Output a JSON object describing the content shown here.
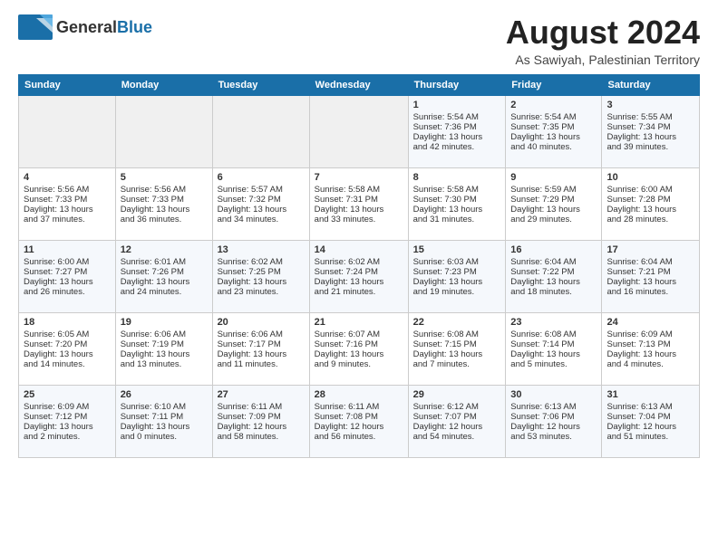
{
  "header": {
    "logo_general": "General",
    "logo_blue": "Blue",
    "month_title": "August 2024",
    "location": "As Sawiyah, Palestinian Territory"
  },
  "days_of_week": [
    "Sunday",
    "Monday",
    "Tuesday",
    "Wednesday",
    "Thursday",
    "Friday",
    "Saturday"
  ],
  "weeks": [
    [
      {
        "day": "",
        "info": ""
      },
      {
        "day": "",
        "info": ""
      },
      {
        "day": "",
        "info": ""
      },
      {
        "day": "",
        "info": ""
      },
      {
        "day": "1",
        "info": "Sunrise: 5:54 AM\nSunset: 7:36 PM\nDaylight: 13 hours\nand 42 minutes."
      },
      {
        "day": "2",
        "info": "Sunrise: 5:54 AM\nSunset: 7:35 PM\nDaylight: 13 hours\nand 40 minutes."
      },
      {
        "day": "3",
        "info": "Sunrise: 5:55 AM\nSunset: 7:34 PM\nDaylight: 13 hours\nand 39 minutes."
      }
    ],
    [
      {
        "day": "4",
        "info": "Sunrise: 5:56 AM\nSunset: 7:33 PM\nDaylight: 13 hours\nand 37 minutes."
      },
      {
        "day": "5",
        "info": "Sunrise: 5:56 AM\nSunset: 7:33 PM\nDaylight: 13 hours\nand 36 minutes."
      },
      {
        "day": "6",
        "info": "Sunrise: 5:57 AM\nSunset: 7:32 PM\nDaylight: 13 hours\nand 34 minutes."
      },
      {
        "day": "7",
        "info": "Sunrise: 5:58 AM\nSunset: 7:31 PM\nDaylight: 13 hours\nand 33 minutes."
      },
      {
        "day": "8",
        "info": "Sunrise: 5:58 AM\nSunset: 7:30 PM\nDaylight: 13 hours\nand 31 minutes."
      },
      {
        "day": "9",
        "info": "Sunrise: 5:59 AM\nSunset: 7:29 PM\nDaylight: 13 hours\nand 29 minutes."
      },
      {
        "day": "10",
        "info": "Sunrise: 6:00 AM\nSunset: 7:28 PM\nDaylight: 13 hours\nand 28 minutes."
      }
    ],
    [
      {
        "day": "11",
        "info": "Sunrise: 6:00 AM\nSunset: 7:27 PM\nDaylight: 13 hours\nand 26 minutes."
      },
      {
        "day": "12",
        "info": "Sunrise: 6:01 AM\nSunset: 7:26 PM\nDaylight: 13 hours\nand 24 minutes."
      },
      {
        "day": "13",
        "info": "Sunrise: 6:02 AM\nSunset: 7:25 PM\nDaylight: 13 hours\nand 23 minutes."
      },
      {
        "day": "14",
        "info": "Sunrise: 6:02 AM\nSunset: 7:24 PM\nDaylight: 13 hours\nand 21 minutes."
      },
      {
        "day": "15",
        "info": "Sunrise: 6:03 AM\nSunset: 7:23 PM\nDaylight: 13 hours\nand 19 minutes."
      },
      {
        "day": "16",
        "info": "Sunrise: 6:04 AM\nSunset: 7:22 PM\nDaylight: 13 hours\nand 18 minutes."
      },
      {
        "day": "17",
        "info": "Sunrise: 6:04 AM\nSunset: 7:21 PM\nDaylight: 13 hours\nand 16 minutes."
      }
    ],
    [
      {
        "day": "18",
        "info": "Sunrise: 6:05 AM\nSunset: 7:20 PM\nDaylight: 13 hours\nand 14 minutes."
      },
      {
        "day": "19",
        "info": "Sunrise: 6:06 AM\nSunset: 7:19 PM\nDaylight: 13 hours\nand 13 minutes."
      },
      {
        "day": "20",
        "info": "Sunrise: 6:06 AM\nSunset: 7:17 PM\nDaylight: 13 hours\nand 11 minutes."
      },
      {
        "day": "21",
        "info": "Sunrise: 6:07 AM\nSunset: 7:16 PM\nDaylight: 13 hours\nand 9 minutes."
      },
      {
        "day": "22",
        "info": "Sunrise: 6:08 AM\nSunset: 7:15 PM\nDaylight: 13 hours\nand 7 minutes."
      },
      {
        "day": "23",
        "info": "Sunrise: 6:08 AM\nSunset: 7:14 PM\nDaylight: 13 hours\nand 5 minutes."
      },
      {
        "day": "24",
        "info": "Sunrise: 6:09 AM\nSunset: 7:13 PM\nDaylight: 13 hours\nand 4 minutes."
      }
    ],
    [
      {
        "day": "25",
        "info": "Sunrise: 6:09 AM\nSunset: 7:12 PM\nDaylight: 13 hours\nand 2 minutes."
      },
      {
        "day": "26",
        "info": "Sunrise: 6:10 AM\nSunset: 7:11 PM\nDaylight: 13 hours\nand 0 minutes."
      },
      {
        "day": "27",
        "info": "Sunrise: 6:11 AM\nSunset: 7:09 PM\nDaylight: 12 hours\nand 58 minutes."
      },
      {
        "day": "28",
        "info": "Sunrise: 6:11 AM\nSunset: 7:08 PM\nDaylight: 12 hours\nand 56 minutes."
      },
      {
        "day": "29",
        "info": "Sunrise: 6:12 AM\nSunset: 7:07 PM\nDaylight: 12 hours\nand 54 minutes."
      },
      {
        "day": "30",
        "info": "Sunrise: 6:13 AM\nSunset: 7:06 PM\nDaylight: 12 hours\nand 53 minutes."
      },
      {
        "day": "31",
        "info": "Sunrise: 6:13 AM\nSunset: 7:04 PM\nDaylight: 12 hours\nand 51 minutes."
      }
    ]
  ]
}
